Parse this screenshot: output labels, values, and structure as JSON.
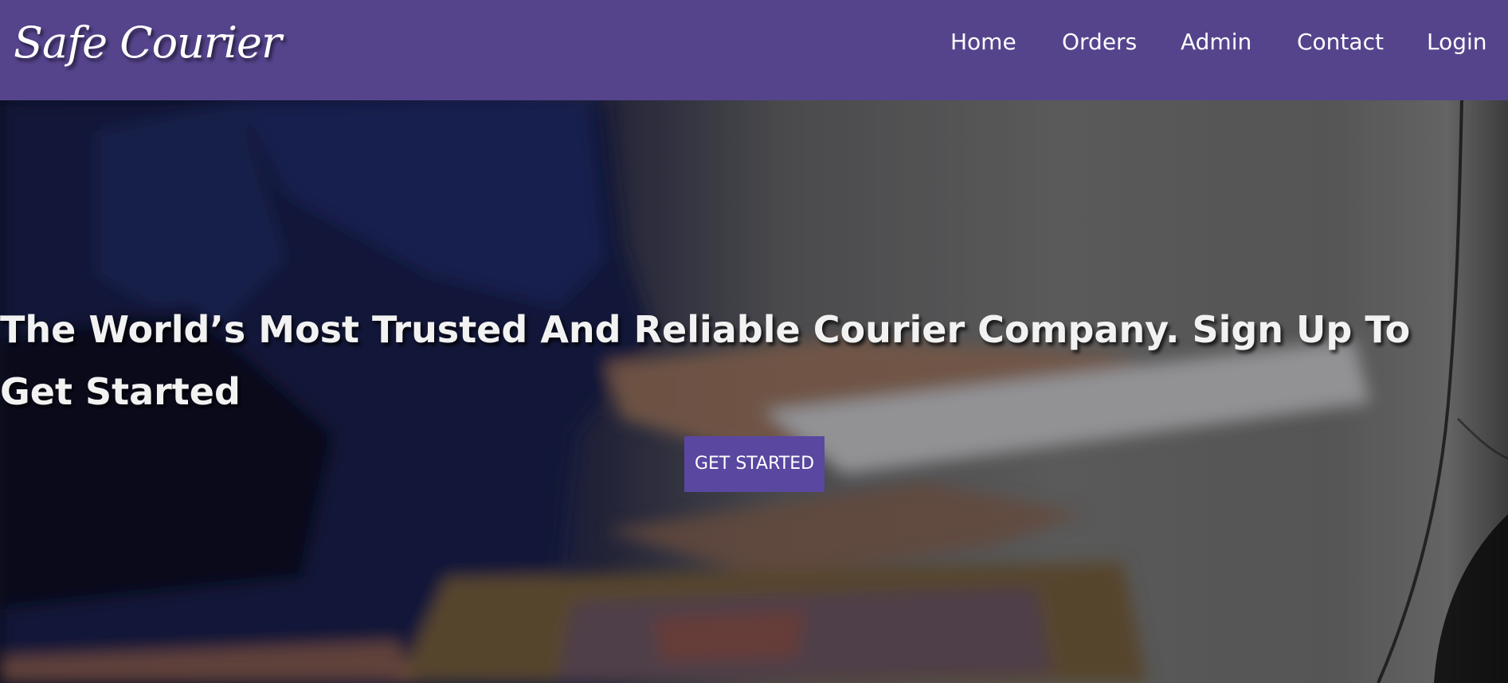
{
  "navbar": {
    "brand": "Safe Courier",
    "links": [
      {
        "label": "Home"
      },
      {
        "label": "Orders"
      },
      {
        "label": "Admin"
      },
      {
        "label": "Contact"
      },
      {
        "label": "Login"
      }
    ],
    "colors": {
      "background": "#55448c",
      "text": "#ffffff"
    }
  },
  "hero": {
    "headline": "The World’s Most Trusted And Reliable Courier Company. Sign Up To Get Started",
    "cta_label": "GET STARTED",
    "background_icon": "courier-delivery-photo",
    "colors": {
      "cta_background": "#5a47a0",
      "headline_text": "#f2f2f2"
    }
  }
}
